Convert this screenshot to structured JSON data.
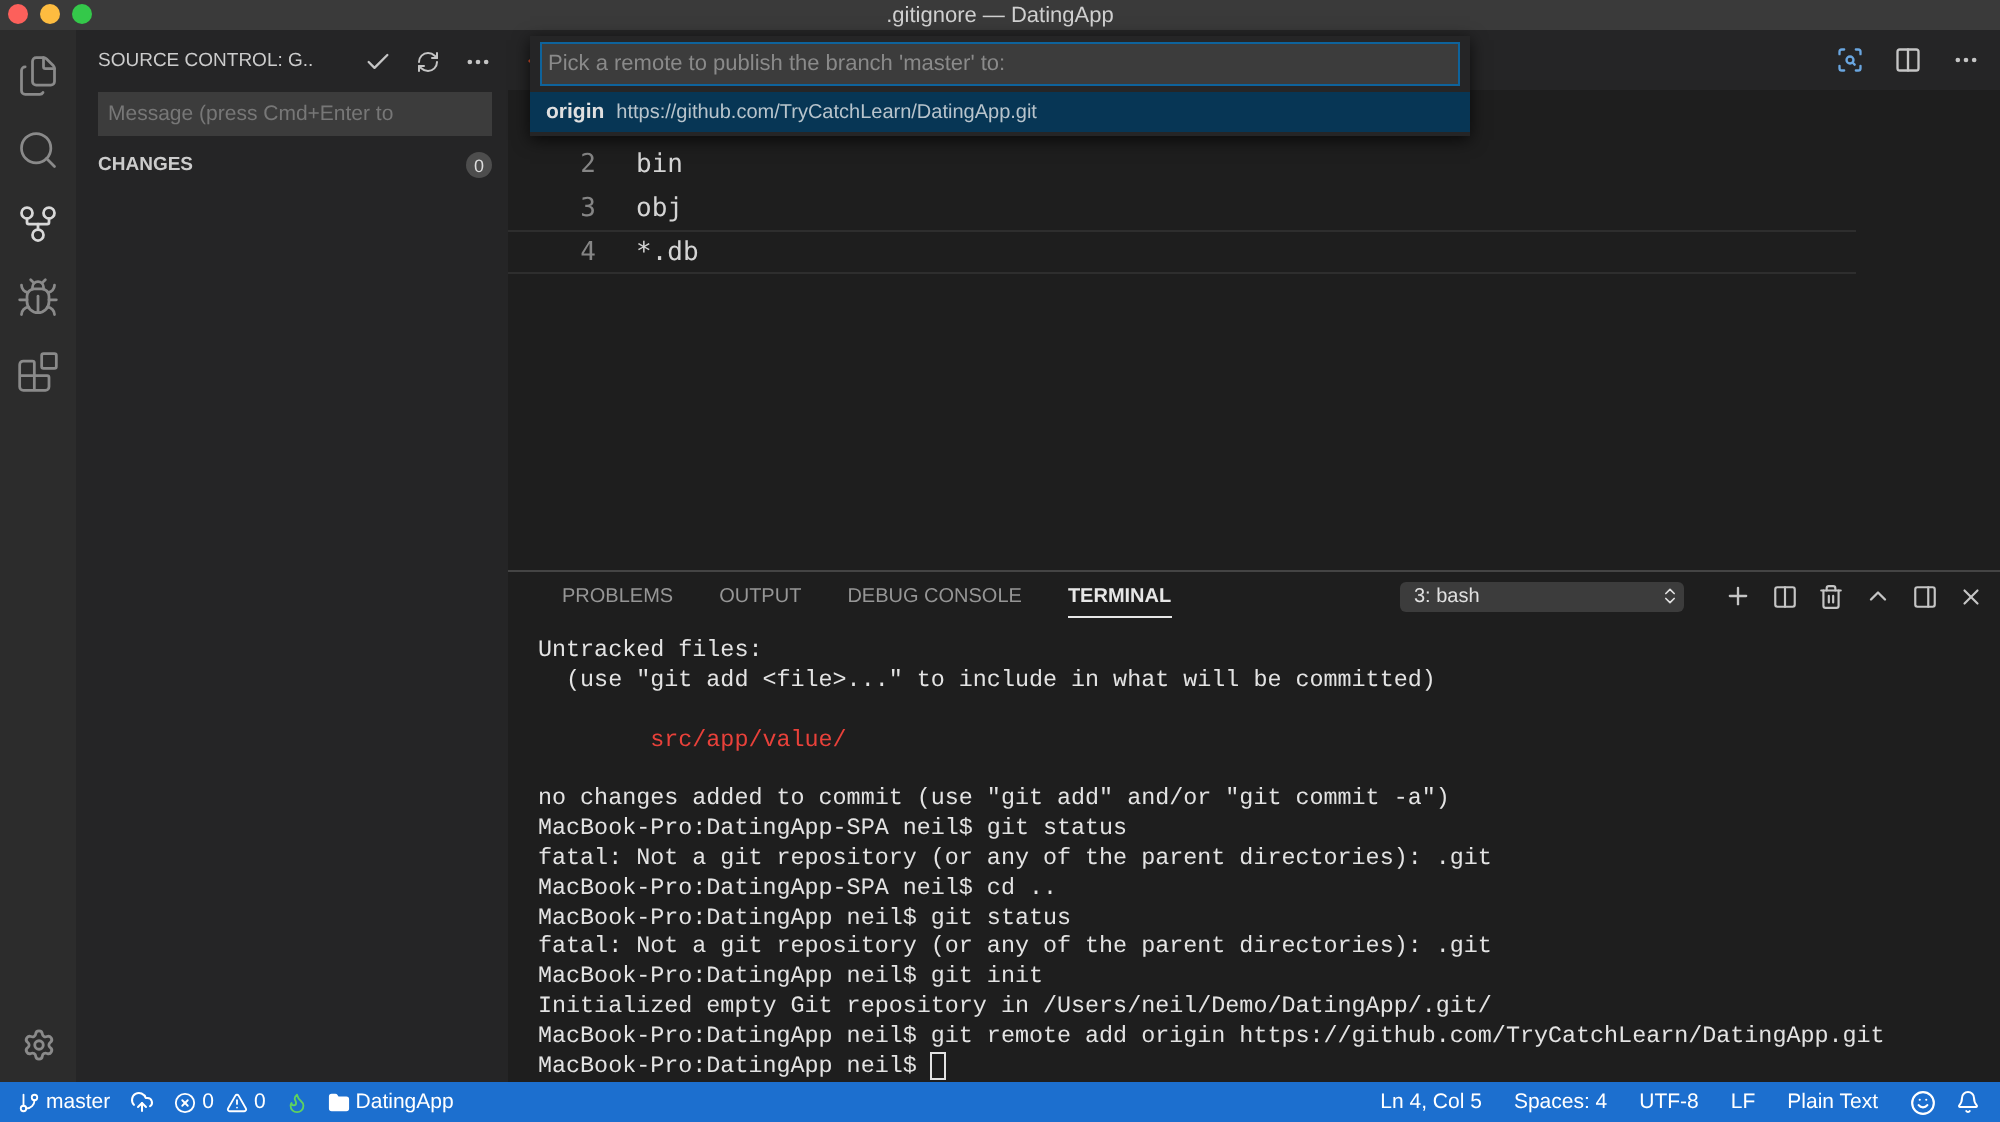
{
  "window": {
    "title": ".gitignore — DatingApp"
  },
  "activity_bar": [
    {
      "kind": "files",
      "selected": false
    },
    {
      "kind": "search",
      "selected": false
    },
    {
      "kind": "git",
      "selected": true
    },
    {
      "kind": "debug",
      "selected": false
    },
    {
      "kind": "extensions",
      "selected": false
    }
  ],
  "sidebar": {
    "title": "SOURCE CONTROL: G..",
    "message": {
      "placeholder": "Message (press Cmd+Enter to"
    },
    "section": {
      "label": "CHANGES",
      "count": "0"
    }
  },
  "editor": {
    "lines": [
      {
        "number": "2",
        "text": "bin"
      },
      {
        "number": "3",
        "text": "obj"
      },
      {
        "number": "4",
        "text": "*.db"
      }
    ]
  },
  "quick_pick": {
    "placeholder": "Pick a remote to publish the branch 'master' to:",
    "items": [
      {
        "name": "origin",
        "detail": "https://github.com/TryCatchLearn/DatingApp.git",
        "selected": true
      }
    ]
  },
  "panel": {
    "tabs": [
      {
        "label": "PROBLEMS",
        "selected": false
      },
      {
        "label": "OUTPUT",
        "selected": false
      },
      {
        "label": "DEBUG CONSOLE",
        "selected": false
      },
      {
        "label": "TERMINAL",
        "selected": true
      }
    ],
    "terminal_select": "3: bash",
    "terminal": {
      "cursor": true,
      "lines": [
        {
          "kind": "output",
          "text": "Untracked files:"
        },
        {
          "kind": "output",
          "text": "  (use \"git add <file>...\" to include in what will be committed)"
        },
        {
          "kind": "blank"
        },
        {
          "kind": "untracked",
          "text": "        src/app/value/"
        },
        {
          "kind": "blank"
        },
        {
          "kind": "output",
          "text": "no changes added to commit (use \"git add\" and/or \"git commit -a\")"
        },
        {
          "kind": "output",
          "text": "MacBook-Pro:DatingApp-SPA neil$ git status"
        },
        {
          "kind": "output",
          "text": "fatal: Not a git repository (or any of the parent directories): .git"
        },
        {
          "kind": "output",
          "text": "MacBook-Pro:DatingApp-SPA neil$ cd .."
        },
        {
          "kind": "output",
          "text": "MacBook-Pro:DatingApp neil$ git status"
        },
        {
          "kind": "output",
          "text": "fatal: Not a git repository (or any of the parent directories): .git"
        },
        {
          "kind": "output",
          "text": "MacBook-Pro:DatingApp neil$ git init"
        },
        {
          "kind": "output",
          "text": "Initialized empty Git repository in /Users/neil/Demo/DatingApp/.git/"
        },
        {
          "kind": "output",
          "text": "MacBook-Pro:DatingApp neil$ git remote add origin https://github.com/TryCatchLearn/DatingApp.git"
        },
        {
          "kind": "output",
          "text": "MacBook-Pro:DatingApp neil$ "
        }
      ]
    }
  },
  "status_bar": {
    "branch": "master",
    "errors": "0",
    "warnings": "0",
    "folder": "DatingApp",
    "right": [
      "Ln 4, Col 5",
      "Spaces: 4",
      "UTF-8",
      "LF",
      "Plain Text"
    ]
  }
}
